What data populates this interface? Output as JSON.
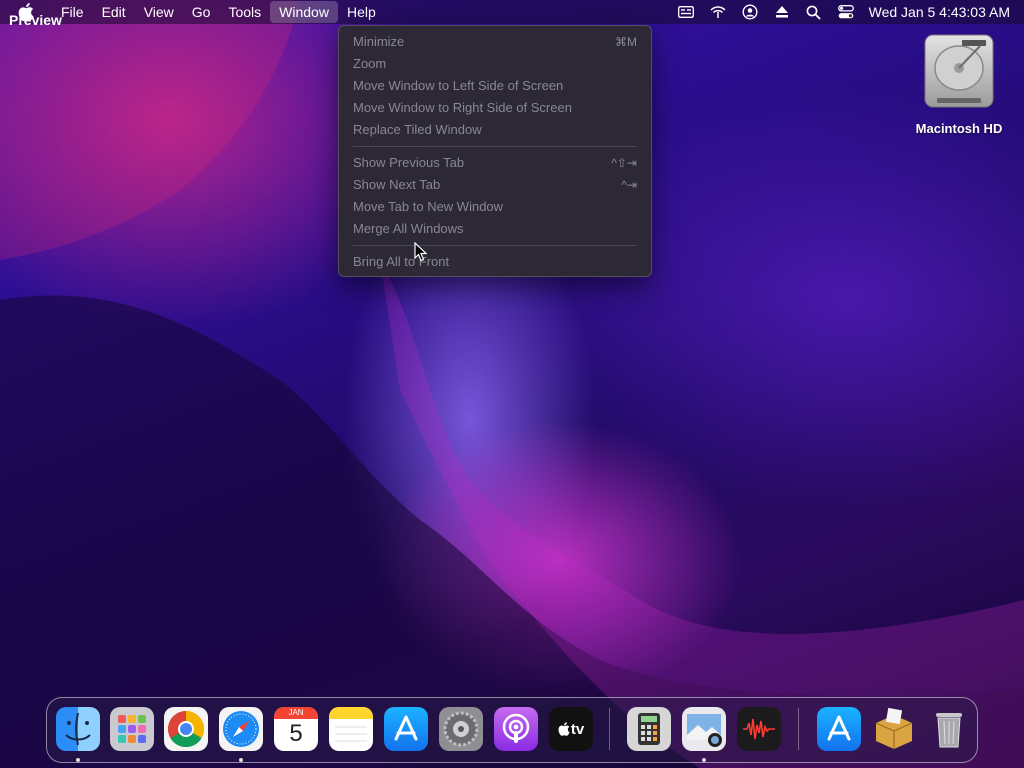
{
  "menubar": {
    "app_name": "Preview",
    "items": [
      "File",
      "Edit",
      "View",
      "Go",
      "Tools",
      "Window",
      "Help"
    ],
    "active_item": "Window",
    "clock": "Wed Jan 5  4:43:03 AM",
    "status_icons": [
      "keyboard-icon",
      "wifi-icon",
      "user-icon",
      "eject-icon",
      "spotlight-icon",
      "control-center-icon"
    ]
  },
  "window_menu": {
    "group1": [
      {
        "label": "Minimize",
        "shortcut": "⌘M"
      },
      {
        "label": "Zoom",
        "shortcut": ""
      },
      {
        "label": "Move Window to Left Side of Screen",
        "shortcut": ""
      },
      {
        "label": "Move Window to Right Side of Screen",
        "shortcut": ""
      },
      {
        "label": "Replace Tiled Window",
        "shortcut": ""
      }
    ],
    "group2": [
      {
        "label": "Show Previous Tab",
        "shortcut": "^⇧⇥"
      },
      {
        "label": "Show Next Tab",
        "shortcut": "^⇥"
      },
      {
        "label": "Move Tab to New Window",
        "shortcut": ""
      },
      {
        "label": "Merge All Windows",
        "shortcut": ""
      }
    ],
    "group3": [
      {
        "label": "Bring All to Front",
        "shortcut": ""
      }
    ]
  },
  "desktop": {
    "drive_label": "Macintosh HD"
  },
  "dock": {
    "apps": [
      "Finder",
      "Launchpad",
      "Chrome",
      "Safari",
      "Calendar",
      "Notes",
      "App Store",
      "System Preferences",
      "Podcasts",
      "TV",
      "Calculator",
      "Preview",
      "Voice Memos",
      "App Store Downloads",
      "Installer",
      "Trash"
    ],
    "calendar_month": "JAN",
    "calendar_day": "5",
    "tv_label": "tv"
  },
  "colors": {
    "accent": "#1e8bf5",
    "menu_text_disabled": "#8a8790"
  }
}
